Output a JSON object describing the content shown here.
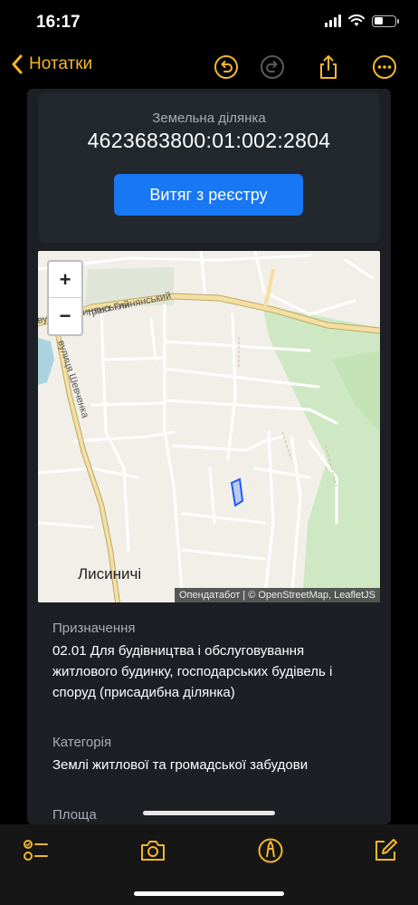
{
  "status_bar": {
    "time": "16:17"
  },
  "nav": {
    "back_label": "Нотатки"
  },
  "parcel": {
    "label": "Земельна ділянка",
    "number": "4623683800:01:002:2804",
    "registry_button": "Витяг з реєстру"
  },
  "map": {
    "zoom_in": "+",
    "zoom_out": "−",
    "streets": [
      "вулиця Глинянський",
      "тракт Глинянський",
      "вулиця Шевченка"
    ],
    "place": "Лисиничі",
    "attribution": "Опендатабот | © OpenStreetMap, LeafletJS"
  },
  "fields": [
    {
      "label": "Призначення",
      "value": "02.01 Для будівництва і обслуговування житлового будинку, господарських будівель і споруд (присадибна ділянка)"
    },
    {
      "label": "Категорія",
      "value": "Землі житлової та громадської забудови"
    },
    {
      "label": "Площа",
      "value": ""
    }
  ],
  "colors": {
    "accent": "#f5b72a",
    "button": "#1877f2",
    "card": "#1c1f24",
    "parcel_outline": "#1e5bff"
  }
}
